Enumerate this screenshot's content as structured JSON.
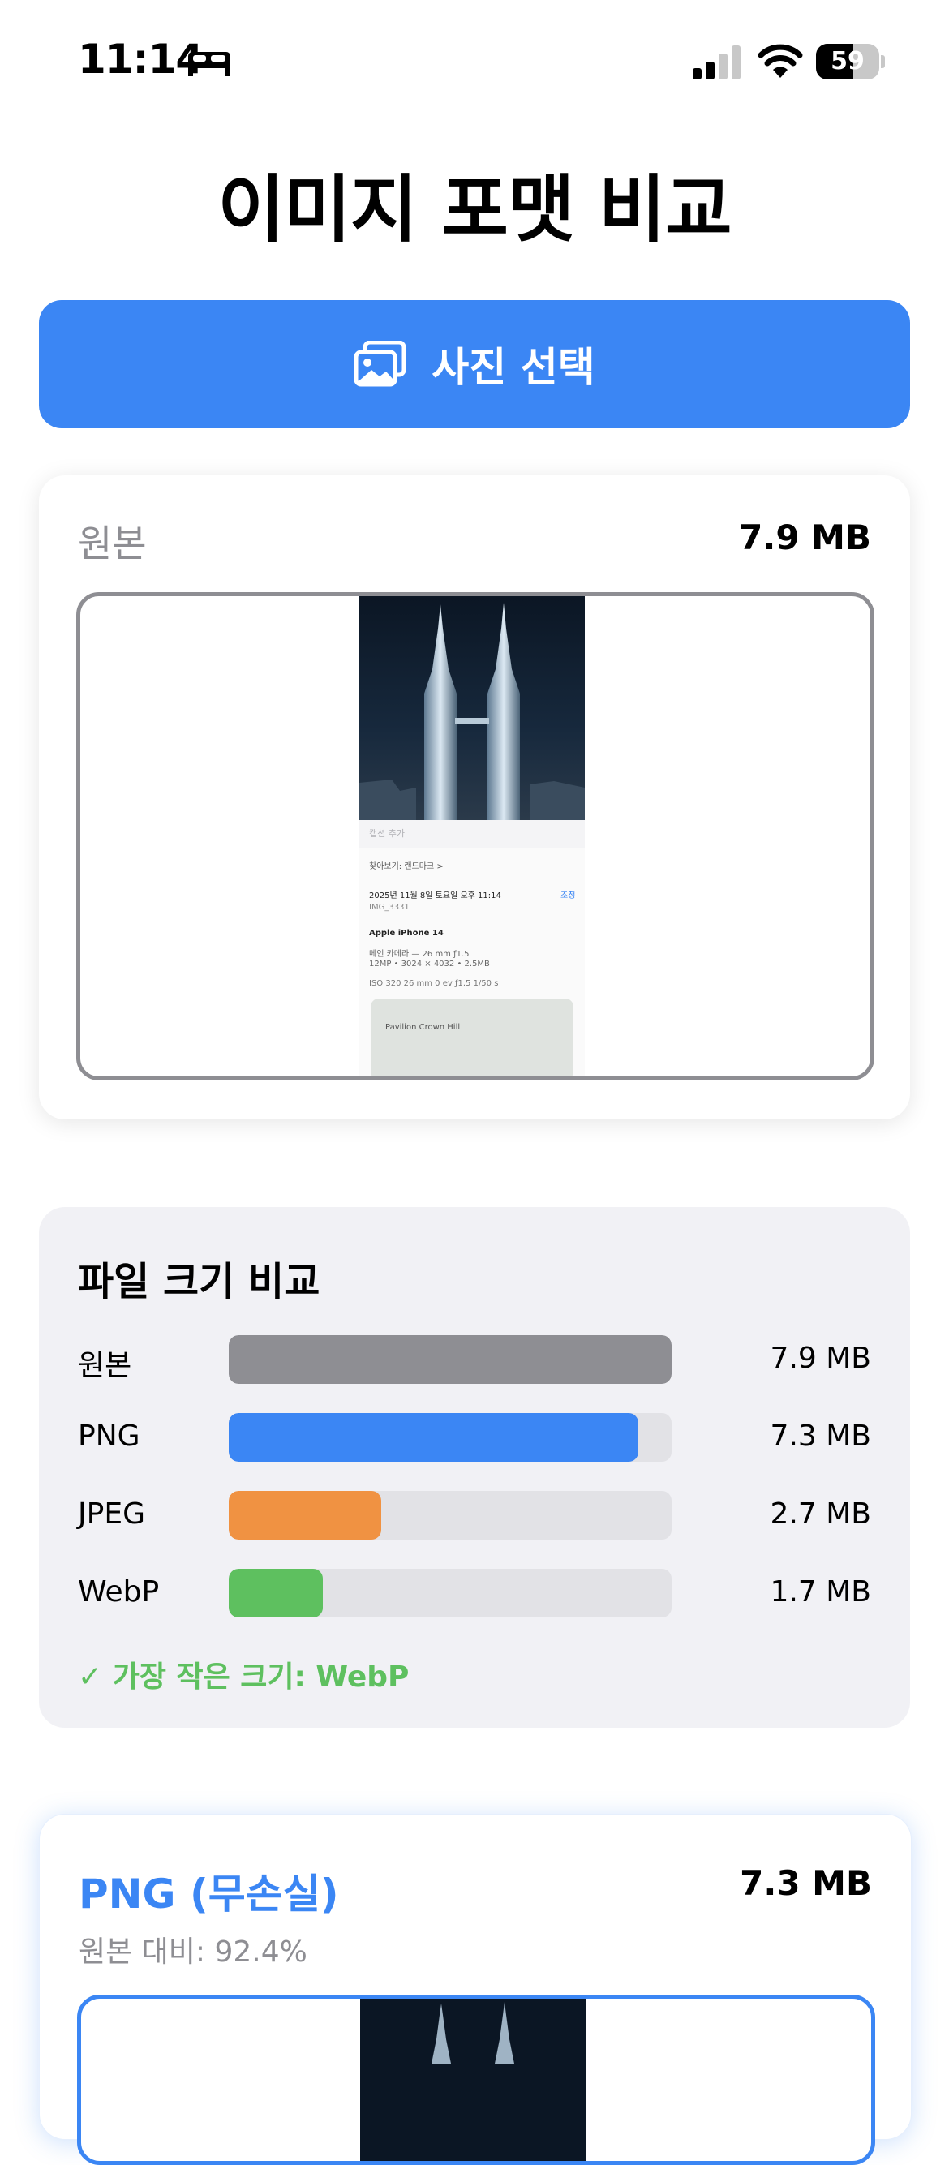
{
  "status_bar": {
    "time": "11:14",
    "battery": "59",
    "battery_level": 0.59
  },
  "title": "이미지 포맷 비교",
  "select_button": {
    "label": "사진 선택",
    "icon": "photos-icon"
  },
  "original_card": {
    "label": "원본",
    "size": "7.9 MB",
    "preview": {
      "caption": "캡션 추가",
      "lookup": "찾아보기: 랜드마크 >",
      "date": "2025년 11월 8일 토요일 오후 11:14",
      "adjust": "조정",
      "filename": "IMG_3331",
      "device": "Apple iPhone 14",
      "camera": "메인 카메라 — 26 mm ƒ1.5",
      "specs": "12MP • 3024 × 4032 • 2.5MB",
      "exif": "ISO 320   26 mm   0 ev   ƒ1.5   1/50 s",
      "map_place": "Pavilion Crown Hill"
    }
  },
  "size_comparison": {
    "title": "파일 크기 비교",
    "rows": [
      {
        "label": "원본",
        "value": "7.9 MB",
        "fraction": 1.0,
        "color": "#8e8e93"
      },
      {
        "label": "PNG",
        "value": "7.3 MB",
        "fraction": 0.924,
        "color": "#3b86f4"
      },
      {
        "label": "JPEG",
        "value": "2.7 MB",
        "fraction": 0.345,
        "color": "#f09242"
      },
      {
        "label": "WebP",
        "value": "1.7 MB",
        "fraction": 0.212,
        "color": "#5ec05f"
      }
    ],
    "smallest": "✓ 가장 작은 크기: WebP"
  },
  "png_card": {
    "title": "PNG (무손실)",
    "size": "7.3 MB",
    "ratio": "원본 대비: 92.4%"
  }
}
